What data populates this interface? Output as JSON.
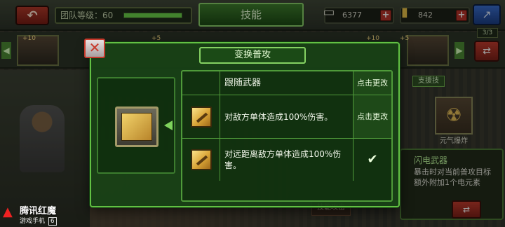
{
  "top_bar": {
    "back_icon": "back-arrow-icon",
    "team_level_text": "团队等级：60",
    "team_level_progress": 1.0,
    "screen_title": "技能",
    "currencies": [
      {
        "icon": "chip-icon",
        "amount": "6377",
        "plus": "+"
      },
      {
        "icon": "gold-bar-icon",
        "amount": "842",
        "plus": "+"
      }
    ],
    "share_icon": "share-icon"
  },
  "hero_strip": {
    "badges": [
      "+10",
      "+5",
      "+10",
      "+5"
    ],
    "count": "3/3"
  },
  "support": {
    "label": "支援技",
    "slot_label": "元气爆炸"
  },
  "weapon_panel": {
    "name": "闪电武器",
    "description": "暴击时对当前普攻目标额外附加1个电元素"
  },
  "background_buttons": {
    "bottom_label": "技能攻击"
  },
  "modal": {
    "title": "变换普攻",
    "close_icon": "close-icon",
    "current_icon": "wrench-attack-icon",
    "options": [
      {
        "description": "跟随武器",
        "action": "点击更改",
        "selected": false,
        "has_icon": false
      },
      {
        "description": "对敌方单体造成100%伤害。",
        "action": "点击更改",
        "selected": false,
        "has_icon": true
      },
      {
        "description": "对远距离敌方单体造成100%伤害。",
        "action": "",
        "selected": true,
        "has_icon": true
      }
    ]
  },
  "brand": {
    "name": "腾讯红魔",
    "sub": "游戏手机",
    "num": "6"
  },
  "colors": {
    "panel_border": "#62c043",
    "panel_bg": "#184216",
    "danger": "#c83a2c"
  }
}
